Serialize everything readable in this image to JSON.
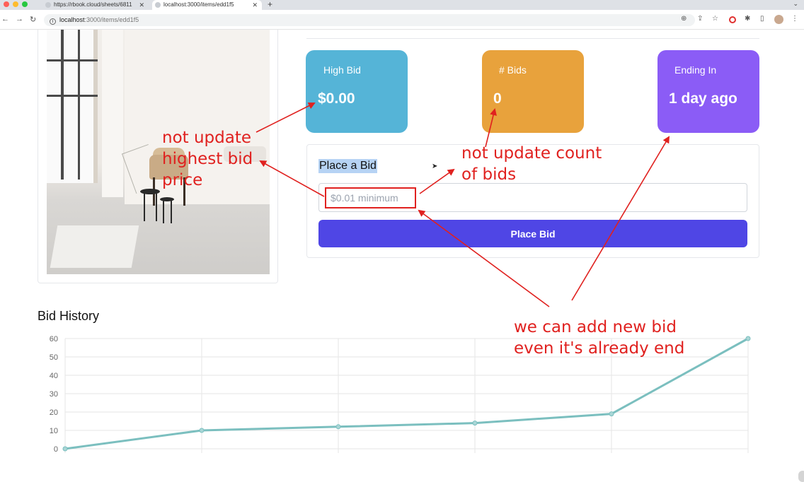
{
  "browser": {
    "tabs": [
      {
        "title": "https://rbook.cloud/sheets/6811"
      },
      {
        "title": "localhost:3000/items/edd1f5"
      }
    ],
    "url": {
      "host": "localhost",
      "path": ":3000/items/edd1f5"
    }
  },
  "stats": {
    "high_bid": {
      "label": "High Bid",
      "value": "$0.00"
    },
    "bids": {
      "label": "# Bids",
      "value": "0"
    },
    "ending": {
      "label": "Ending In",
      "value": "1 day ago"
    }
  },
  "bid_form": {
    "title": "Place a Bid",
    "placeholder": "$0.01 minimum",
    "button_label": "Place Bid"
  },
  "history": {
    "title": "Bid History"
  },
  "chart_data": {
    "type": "line",
    "title": "Bid History",
    "xlabel": "",
    "ylabel": "",
    "x": [
      0,
      1,
      2,
      3,
      4,
      5
    ],
    "values": [
      0,
      10,
      12,
      14,
      19,
      60
    ],
    "ylim": [
      0,
      60
    ],
    "yticks": [
      0,
      10,
      20,
      30,
      40,
      50,
      60
    ],
    "grid": true,
    "color": "#7bbfbf"
  },
  "annotations": {
    "high_bid_note": [
      "not update",
      "highest bid",
      "price"
    ],
    "count_note": [
      "not update count",
      "of bids"
    ],
    "ended_note": [
      "we can add new bid",
      "even it's already end"
    ],
    "color": "#e0211f"
  },
  "colors": {
    "high_bid": "#55b4d7",
    "bids": "#e8a23c",
    "ending": "#8b5cf6",
    "button": "#4f46e5"
  }
}
